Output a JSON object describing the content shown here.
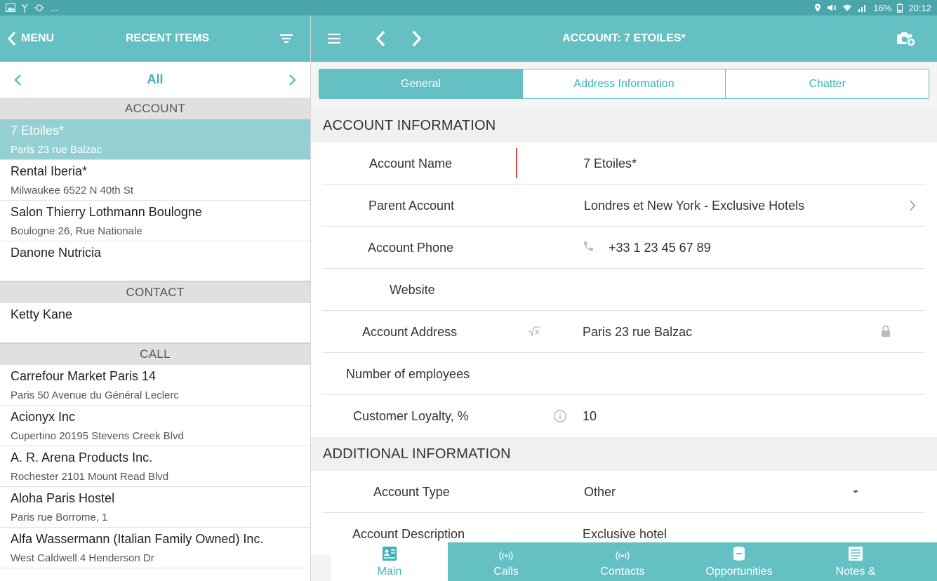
{
  "statusbar": {
    "battery": "16%",
    "time": "20:12",
    "notif": "..."
  },
  "left": {
    "back_label": "MENU",
    "title": "RECENT ITEMS",
    "pager": {
      "label": "All"
    },
    "sections": [
      {
        "header": "ACCOUNT",
        "items": [
          {
            "name": "7 Etoiles*",
            "sub": "Paris 23 rue Balzac",
            "selected": true
          },
          {
            "name": "Rental Iberia*",
            "sub": "Milwaukee 6522 N 40th St"
          },
          {
            "name": "Salon Thierry Lothmann Boulogne",
            "sub": "Boulogne 26, Rue Nationale"
          },
          {
            "name": "Danone Nutricia",
            "sub": ""
          }
        ]
      },
      {
        "header": "CONTACT",
        "items": [
          {
            "name": "Ketty Kane",
            "sub": ""
          }
        ]
      },
      {
        "header": "CALL",
        "items": [
          {
            "name": "Carrefour Market Paris 14",
            "sub": "Paris 50 Avenue du Général Leclerc"
          },
          {
            "name": "Acionyx Inc",
            "sub": "Cupertino 20195 Stevens Creek Blvd"
          },
          {
            "name": "A. R. Arena Products Inc.",
            "sub": "Rochester 2101 Mount Read Blvd"
          },
          {
            "name": "Aloha Paris Hostel",
            "sub": "Paris rue Borrome, 1"
          },
          {
            "name": "Alfa Wassermann (Italian Family Owned) Inc.",
            "sub": "West Caldwell 4 Henderson Dr"
          }
        ]
      }
    ]
  },
  "right": {
    "title": "ACCOUNT: 7 ETOILES*",
    "tabs": [
      {
        "label": "General",
        "active": true
      },
      {
        "label": "Address Information"
      },
      {
        "label": "Chatter"
      }
    ],
    "section1": "ACCOUNT INFORMATION",
    "fields1": [
      {
        "label": "Account Name",
        "value": "7 Etoiles*"
      },
      {
        "label": "Parent Account",
        "value": "Londres et New York - Exclusive Hotels"
      },
      {
        "label": "Account Phone",
        "value": "+33 1 23 45 67 89"
      },
      {
        "label": "Website",
        "value": ""
      },
      {
        "label": "Account Address",
        "value": "Paris 23 rue Balzac"
      },
      {
        "label": "Number of employees",
        "value": ""
      },
      {
        "label": "Customer Loyalty, %",
        "value": "10"
      }
    ],
    "section2": "ADDITIONAL INFORMATION",
    "fields2": [
      {
        "label": "Account Type",
        "value": "Other"
      },
      {
        "label": "Account Description",
        "value": "Exclusive hotel"
      }
    ],
    "nav": [
      {
        "label": "Main",
        "active": true
      },
      {
        "label": "Calls"
      },
      {
        "label": "Contacts"
      },
      {
        "label": "Opportunities"
      },
      {
        "label": "Notes &"
      }
    ]
  },
  "colors": {
    "accent": "#64c0c2",
    "accent_text": "#3db3b6",
    "selected": "#94d0d2",
    "status": "#4aa6aa"
  }
}
